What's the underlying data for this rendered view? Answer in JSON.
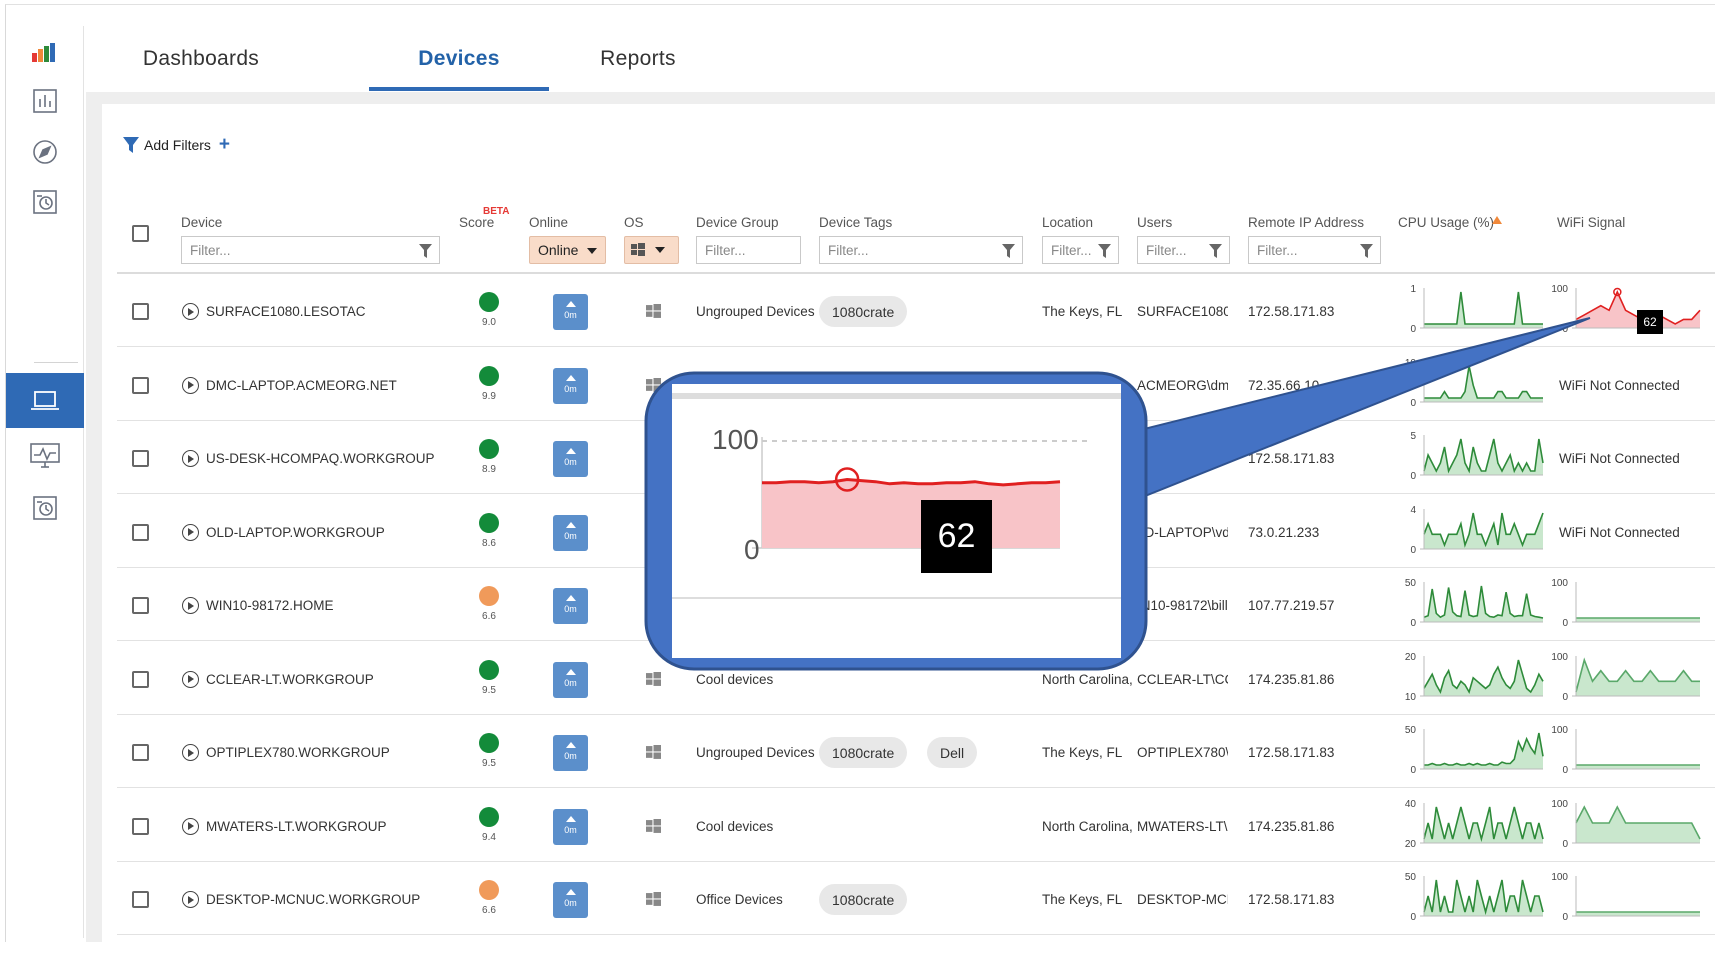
{
  "nav": {
    "tabs": [
      {
        "label": "Dashboards"
      },
      {
        "label": "Devices"
      },
      {
        "label": "Reports"
      }
    ],
    "sidebar_icons": [
      "logo-bars-icon",
      "bar-chart-icon",
      "compass-icon",
      "history-icon",
      "laptop-icon",
      "monitor-pulse-icon",
      "history-icon"
    ]
  },
  "filters": {
    "add_label": "Add Filters",
    "placeholder": "Filter...",
    "short_placeholder": "Filter...",
    "online_value": "Online"
  },
  "columns": {
    "device": "Device",
    "score": "Score",
    "beta": "BETA",
    "online": "Online",
    "os": "OS",
    "group": "Device Group",
    "tags": "Device Tags",
    "location": "Location",
    "users": "Users",
    "remote_ip": "Remote IP Address",
    "cpu": "CPU Usage (%)",
    "wifi": "WiFi Signal"
  },
  "rows": [
    {
      "device": "SURFACE1080.LESOTAC",
      "score": "9.0",
      "score_color": "#138b3a",
      "uptime": "0m",
      "group": "Ungrouped Devices",
      "tags": [
        "1080crate"
      ],
      "location": "The Keys, FL",
      "user": "SURFACE1080\\m",
      "ip": "172.58.171.83",
      "cpu": {
        "max": "1",
        "min": "0",
        "values": [
          0,
          0,
          0,
          0,
          0,
          0,
          0,
          0,
          0,
          1,
          0,
          0,
          0,
          0,
          0,
          0,
          0,
          0,
          0,
          0,
          0,
          0,
          0,
          1,
          0,
          0,
          0,
          0,
          0,
          0
        ]
      },
      "wifi": {
        "mode": "red",
        "max": "100",
        "min": "0",
        "values": [
          60,
          61,
          62,
          63,
          62,
          66,
          62,
          61,
          60,
          60,
          61,
          60,
          59,
          60,
          60,
          62
        ],
        "label": "62"
      }
    },
    {
      "device": "DMC-LAPTOP.ACMEORG.NET",
      "score": "9.9",
      "score_color": "#138b3a",
      "uptime": "0m",
      "group": "",
      "tags": [],
      "location": "",
      "user": "ACMEORG\\dmc",
      "ip": "72.35.66.10",
      "cpu": {
        "max": "10",
        "min": "0",
        "values": [
          0,
          0,
          0,
          0,
          0,
          1,
          0,
          0,
          0,
          0,
          1,
          5,
          2,
          0,
          0,
          0,
          0,
          0,
          1,
          1,
          0,
          0,
          0,
          0,
          1,
          1,
          0,
          0,
          0,
          0
        ]
      },
      "wifi": {
        "mode": "text",
        "text": "WiFi Not Connected"
      }
    },
    {
      "device": "US-DESK-HCOMPAQ.WORKGROUP",
      "score": "8.9",
      "score_color": "#138b3a",
      "uptime": "0m",
      "group": "",
      "tags": [],
      "location": "",
      "user": "",
      "ip": "172.58.171.83",
      "cpu": {
        "max": "5",
        "min": "0",
        "values": [
          0,
          2,
          1,
          0,
          1,
          3,
          0,
          1,
          2,
          4,
          1,
          0,
          3,
          1,
          0,
          0,
          2,
          4,
          1,
          0,
          1,
          2,
          0,
          1,
          0,
          1,
          0,
          0,
          4,
          1
        ]
      },
      "wifi": {
        "mode": "text",
        "text": "WiFi Not Connected"
      }
    },
    {
      "device": "OLD-LAPTOP.WORKGROUP",
      "score": "8.6",
      "score_color": "#138b3a",
      "uptime": "0m",
      "group": "",
      "tags": [],
      "location": "",
      "user": "LD-LAPTOP\\vdu",
      "ip": "73.0.21.233",
      "cpu": {
        "max": "4",
        "min": "0",
        "values": [
          1,
          2,
          1,
          1,
          1,
          0,
          1,
          1,
          1,
          2,
          0,
          1,
          3,
          1,
          1,
          0,
          1,
          2,
          0,
          3,
          1,
          1,
          2,
          1,
          0,
          1,
          1,
          1,
          2,
          3
        ]
      },
      "wifi": {
        "mode": "text",
        "text": "WiFi Not Connected"
      }
    },
    {
      "device": "WIN10-98172.HOME",
      "score": "6.6",
      "score_color": "#f09a5a",
      "uptime": "0m",
      "group": "",
      "tags": [],
      "location": "",
      "user": "IN10-98172\\bill",
      "ip": "107.77.219.57",
      "cpu": {
        "max": "50",
        "min": "0",
        "values": [
          3,
          5,
          40,
          8,
          3,
          6,
          42,
          10,
          5,
          4,
          38,
          6,
          4,
          5,
          44,
          8,
          4,
          3,
          6,
          5,
          36,
          8,
          4,
          5,
          5,
          34,
          6,
          4,
          3,
          2
        ]
      },
      "wifi": {
        "mode": "green",
        "max": "100",
        "min": "0",
        "values": [
          100,
          100,
          100,
          100,
          100,
          100,
          100,
          100
        ]
      }
    },
    {
      "device": "CCLEAR-LT.WORKGROUP",
      "score": "9.5",
      "score_color": "#138b3a",
      "uptime": "0m",
      "group": "Cool devices",
      "tags": [],
      "location": "North Carolina,",
      "user": "CCLEAR-LT\\CClea",
      "ip": "174.235.81.86",
      "cpu": {
        "max": "20",
        "min": "10",
        "values": [
          8,
          10,
          12,
          9,
          7,
          11,
          13,
          9,
          8,
          10,
          9,
          7,
          11,
          10,
          9,
          8,
          9,
          12,
          14,
          11,
          9,
          8,
          10,
          16,
          12,
          8,
          7,
          9,
          12,
          10
        ]
      },
      "wifi": {
        "mode": "green",
        "max": "100",
        "min": "0",
        "values": [
          92,
          95,
          93,
          94,
          93,
          93,
          94,
          93,
          93,
          94,
          93,
          93,
          93,
          94,
          93,
          93
        ]
      }
    },
    {
      "device": "OPTIPLEX780.WORKGROUP",
      "score": "9.5",
      "score_color": "#138b3a",
      "uptime": "0m",
      "group": "Ungrouped Devices",
      "tags": [
        "1080crate",
        "Dell"
      ],
      "location": "The Keys, FL",
      "user": "OPTIPLEX780\\loc",
      "ip": "172.58.171.83",
      "cpu": {
        "max": "50",
        "min": "0",
        "values": [
          2,
          2,
          3,
          2,
          2,
          3,
          2,
          2,
          3,
          2,
          2,
          3,
          2,
          3,
          2,
          2,
          3,
          2,
          2,
          4,
          3,
          3,
          6,
          18,
          12,
          20,
          14,
          10,
          24,
          8
        ]
      },
      "wifi": {
        "mode": "green",
        "max": "100",
        "min": "0",
        "values": [
          100,
          100,
          100,
          100,
          100,
          100,
          100,
          100
        ]
      }
    },
    {
      "device": "MWATERS-LT.WORKGROUP",
      "score": "9.4",
      "score_color": "#138b3a",
      "uptime": "0m",
      "group": "Cool devices",
      "tags": [],
      "location": "North Carolina,",
      "user": "MWATERS-LT\\mw",
      "ip": "174.235.81.86",
      "cpu": {
        "max": "40",
        "min": "20",
        "values": [
          19,
          20,
          19,
          21,
          20,
          19,
          20,
          19,
          20,
          21,
          20,
          19,
          20,
          20,
          19,
          20,
          21,
          19,
          20,
          20,
          19,
          20,
          21,
          20,
          19,
          20,
          20,
          19,
          20,
          19
        ]
      },
      "wifi": {
        "mode": "green",
        "max": "100",
        "min": "0",
        "values": [
          96,
          97,
          96,
          96,
          96,
          97,
          96,
          96,
          96,
          96,
          96,
          96,
          96,
          96,
          96,
          95
        ]
      }
    },
    {
      "device": "DESKTOP-MCNUC.WORKGROUP",
      "score": "6.6",
      "score_color": "#f09a5a",
      "uptime": "0m",
      "group": "Office Devices",
      "tags": [
        "1080crate"
      ],
      "location": "The Keys, FL",
      "user": "DESKTOP-MCNUC",
      "ip": "172.58.171.83",
      "cpu": {
        "max": "50",
        "min": "0",
        "values": [
          28,
          29,
          28,
          30,
          28,
          29,
          28,
          28,
          30,
          29,
          28,
          29,
          28,
          30,
          29,
          28,
          29,
          28,
          29,
          30,
          28,
          29,
          29,
          28,
          30,
          29,
          28,
          29,
          29,
          28
        ]
      },
      "wifi": {
        "mode": "green",
        "max": "100",
        "min": "0",
        "values": [
          100,
          100,
          100,
          100,
          100,
          100,
          100,
          100
        ]
      }
    }
  ],
  "callout": {
    "max": "100",
    "min": "0",
    "value": "62",
    "values": [
      61,
      61,
      62,
      62,
      61,
      62,
      64,
      63,
      62,
      60,
      61,
      60,
      60,
      61,
      61,
      62,
      60,
      59,
      60,
      61,
      61,
      62
    ]
  }
}
